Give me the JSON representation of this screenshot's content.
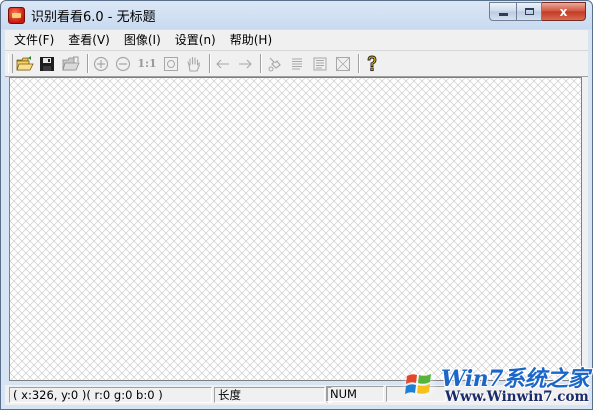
{
  "window": {
    "title": "识别看看6.0 - 无标题",
    "controls": {
      "minimize_icon": "minimize-icon",
      "maximize_icon": "maximize-icon",
      "close_glyph": "x"
    }
  },
  "menubar": {
    "items": [
      {
        "label": "文件(F)"
      },
      {
        "label": "查看(V)"
      },
      {
        "label": "图像(I)"
      },
      {
        "label": "设置(n)"
      },
      {
        "label": "帮助(H)"
      }
    ]
  },
  "toolbar": {
    "buttons": [
      {
        "icon": "open-folder-icon",
        "enabled": true
      },
      {
        "icon": "save-disk-icon",
        "enabled": true
      },
      {
        "icon": "folder-scan-icon",
        "enabled": false
      },
      {
        "icon": "zoom-in-icon",
        "enabled": false
      },
      {
        "icon": "zoom-out-icon",
        "enabled": false
      },
      {
        "icon": "actual-size-icon",
        "label": "1:1",
        "enabled": false
      },
      {
        "icon": "fit-window-icon",
        "enabled": false
      },
      {
        "icon": "hand-pan-icon",
        "enabled": false
      },
      {
        "icon": "arrow-left-icon",
        "enabled": false
      },
      {
        "icon": "arrow-right-icon",
        "enabled": false
      },
      {
        "icon": "crop-icon",
        "enabled": false
      },
      {
        "icon": "text-left-icon",
        "enabled": false
      },
      {
        "icon": "text-columns-icon",
        "enabled": false
      },
      {
        "icon": "select-region-icon",
        "enabled": false
      },
      {
        "icon": "help-icon",
        "enabled": true
      }
    ],
    "accent_help": "#d4a000"
  },
  "statusbar": {
    "coords": "( x:326, y:0 )( r:0 g:0 b:0 )",
    "length_label": "长度",
    "blank": "",
    "num": "NUM",
    "extra": ""
  },
  "watermark": {
    "title": "Win7系统之家",
    "url": "Www.Winwin7.com"
  },
  "colors": {
    "title_bar": "#c9daf0",
    "window_frame": "#5a6f8a",
    "watermark_blue": "#1b66c9",
    "close_button": "#c23a22"
  }
}
